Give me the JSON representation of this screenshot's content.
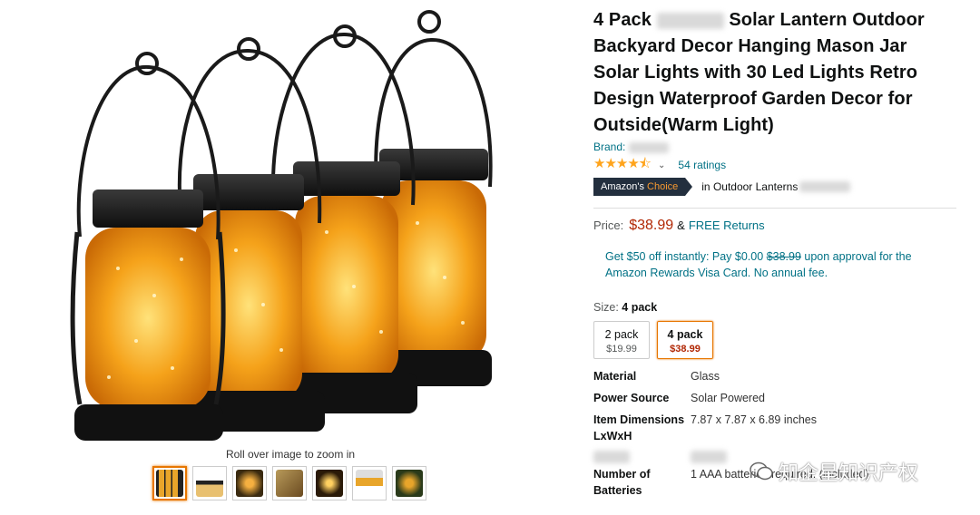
{
  "gallery": {
    "zoom_hint": "Roll over image to zoom in",
    "thumbnails": [
      {
        "icon": "lantern-4pack-thumb",
        "color": "#e8a52a"
      },
      {
        "icon": "lantern-dimensions-thumb",
        "color": "#c9c9c9"
      },
      {
        "icon": "lantern-lifestyle-thumb",
        "color": "#6b4a1a"
      },
      {
        "icon": "lantern-features-thumb",
        "color": "#9a7a3a"
      },
      {
        "icon": "lantern-night-thumb",
        "color": "#3a2a12"
      },
      {
        "icon": "lantern-hanging-thumb",
        "color": "#b89a5a"
      },
      {
        "icon": "lantern-garden-thumb",
        "color": "#4a3a1a"
      }
    ]
  },
  "product": {
    "title_start": "4 Pack",
    "title_rest": "Solar Lantern Outdoor Backyard Decor Hanging Mason Jar Solar Lights with 30 Led Lights Retro Design Waterproof Garden Decor for Outside(Warm Light)",
    "brand_label": "Brand:",
    "stars": "★★★★⯪",
    "star_caret": "⌄",
    "ratings": "54 ratings",
    "badge_prefix": "Amazon's",
    "badge_highlight": "Choice",
    "badge_category": "in Outdoor Lanterns"
  },
  "price": {
    "label": "Price:",
    "value": "$38.99",
    "amp": "&",
    "free_returns": "FREE Returns"
  },
  "promo": {
    "text_1": "Get $50 off instantly: Pay $0.00",
    "strike": "$38.99",
    "text_2": "upon approval for the Amazon Rewards Visa Card. No annual fee."
  },
  "size": {
    "label": "Size:",
    "selected": "4 pack",
    "options": [
      {
        "name": "2 pack",
        "price": "$19.99"
      },
      {
        "name": "4 pack",
        "price": "$38.99"
      }
    ]
  },
  "specs": [
    {
      "key": "Material",
      "value": "Glass"
    },
    {
      "key": "Power Source",
      "value": "Solar Powered"
    },
    {
      "key": "Item Dimensions LxWxH",
      "value": "7.87 x 7.87 x 6.89 inches"
    },
    {
      "key": "Number of Batteries",
      "value": "1 AAA batteries required. (included)"
    }
  ],
  "watermark": "知企星知识产权",
  "colors": {
    "link": "#007185",
    "price": "#b12704",
    "star": "#ffa41c",
    "badge_bg": "#232f3e",
    "selected": "#e77600"
  }
}
